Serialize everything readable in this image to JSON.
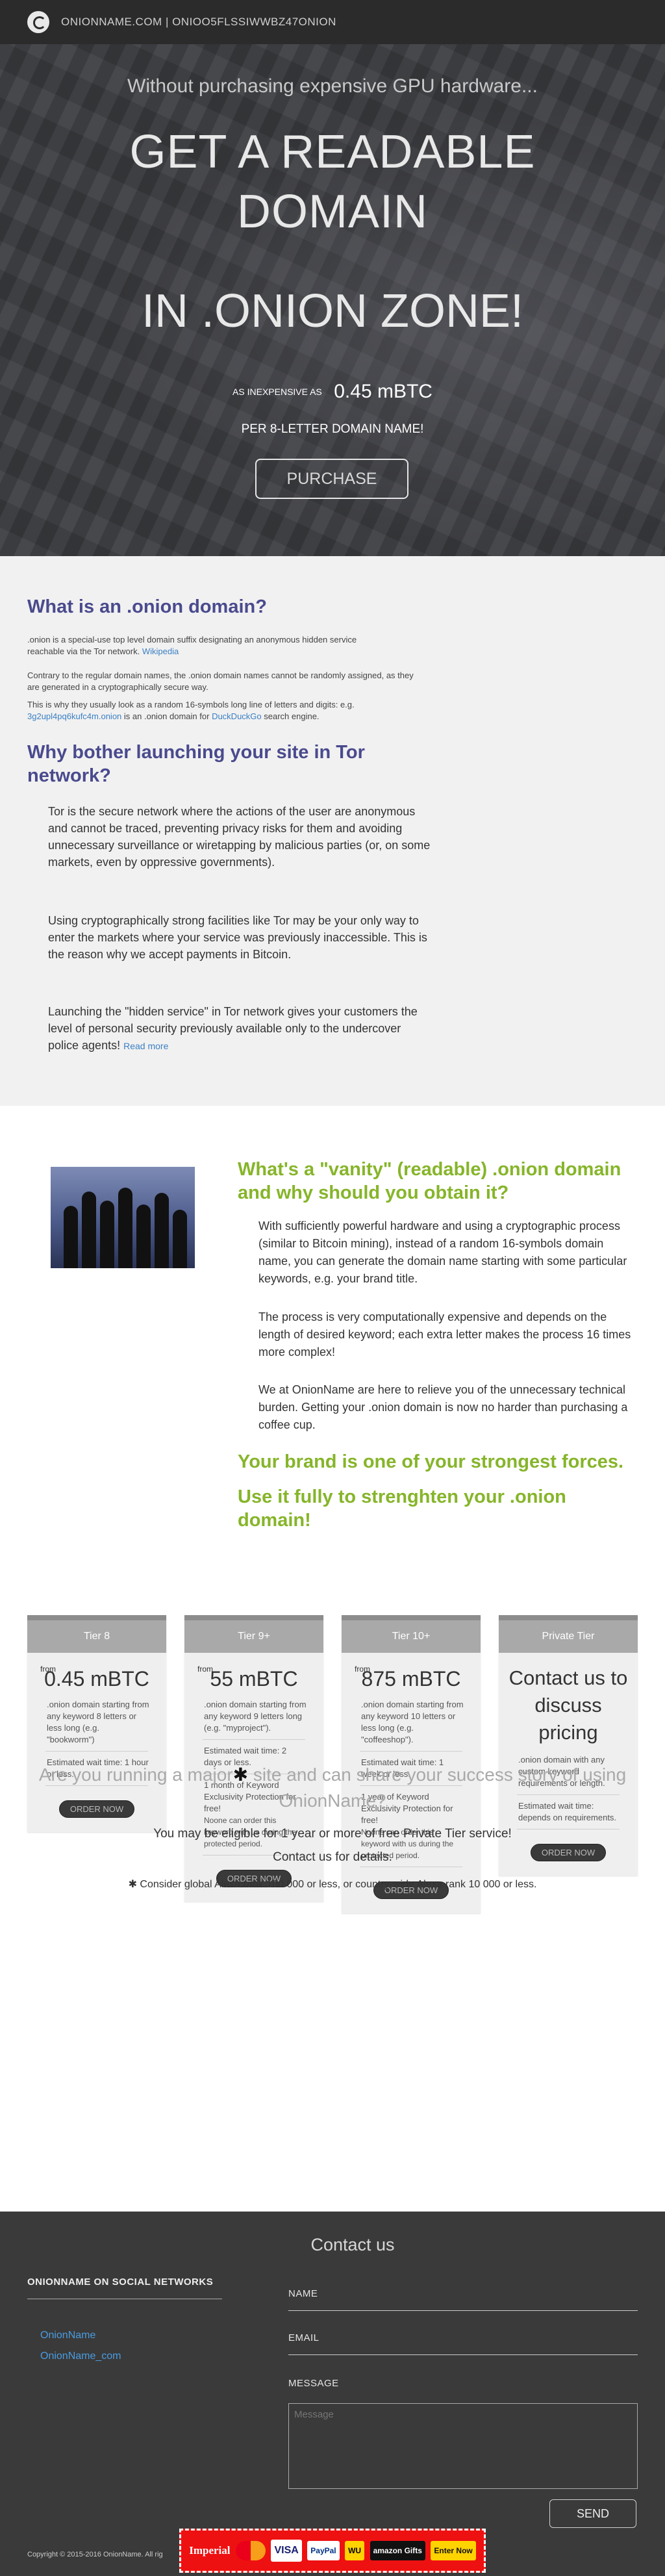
{
  "nav": {
    "brand": "ONIONNAME.COM  |  ONIOO5FLSSIWWBZ47ONION",
    "logo_icon": "onion-logo-icon"
  },
  "hero": {
    "subtitle": "Without purchasing expensive GPU hardware...",
    "headline_line1": "GET A READABLE",
    "headline_line2": "DOMAIN",
    "headline_line3": "IN .ONION ZONE!",
    "price_prefix": "AS INEXPENSIVE AS",
    "price": "0.45 mBTC",
    "per": "PER 8-LETTER DOMAIN NAME!",
    "purchase_label": "PURCHASE"
  },
  "what": {
    "title": "What is an .onion domain?",
    "p1_a": ".onion is a special-use top level domain suffix designating an anonymous hidden service",
    "p1_b": "reachable via the Tor network.",
    "p1_link": "Wikipedia",
    "p2": "Contrary to the regular domain names, the .onion domain names cannot be randomly assigned, as they are generated in a cryptographically secure way.",
    "p3_a": "This is why they usually look as a random 16-symbols long line of letters and digits: e.g.",
    "p3_link1": "3g2upl4pq6kufc4m.onion",
    "p3_b": "is an .onion domain for",
    "p3_link2": "DuckDuckGo",
    "p3_c": "search engine.",
    "title2": "Why bother launching your site in Tor network?",
    "b1": "Tor is the secure network where the actions of the user are anonymous and cannot be traced, preventing privacy risks for them and avoiding unnecessary surveillance or wiretapping by malicious parties (or, on some markets, even by oppressive governments).",
    "b2": "Using cryptographically strong facilities like Tor may be your only way to enter the markets where your service was previously inaccessible. This is the reason why we accept payments in Bitcoin.",
    "b3": "Launching the \"hidden service\" in Tor network gives your customers the level of personal security previously available only to the undercover police agents!",
    "read_more": "Read more"
  },
  "vanity": {
    "image_desc": "people-silhouettes-image",
    "title": "What's a \"vanity\" (readable) .onion domain and why should you obtain it?",
    "p1": "With sufficiently powerful hardware and using a cryptographic process (similar to Bitcoin mining), instead of a random 16-symbols domain name, you can generate the domain name starting with some particular keywords, e.g. your brand title.",
    "p2": "The process is very computationally expensive and depends on the length of desired keyword; each extra letter makes the process 16 times more complex!",
    "p3": "We at OnionName are here to relieve you of the unnecessary technical burden. Getting your .onion domain is now no harder than purchasing a coffee cup.",
    "slogan1": "Your brand is one of your strongest forces.",
    "slogan2": "Use it fully to strenghten your .onion domain!"
  },
  "pricing": {
    "tiers": [
      {
        "name": "Tier 8",
        "currency": "from",
        "price": "0.45 mBTC",
        "l1": ".onion domain starting from any keyword 8 letters or less long (e.g. \"bookworm\")",
        "wait": "Estimated wait time: 1 hour or less.",
        "order": "ORDER NOW"
      },
      {
        "name": "Tier 9+",
        "currency": "from",
        "price": "55 mBTC",
        "l1": ".onion domain starting from any keyword 9 letters long (e.g. \"myproject\").",
        "wait": "Estimated wait time: 2 days or less.",
        "excl": "1 month of Keyword Exclusivity Protection for free!",
        "excl_note": "Noone can order this keyword with us during the protected period.",
        "order": "ORDER NOW"
      },
      {
        "name": "Tier 10+",
        "currency": "from",
        "price": "875 mBTC",
        "l1": ".onion domain starting from any keyword 10 letters or less long (e.g. \"coffeeshop\").",
        "wait": "Estimated wait time: 1 week or less.",
        "excl": "1 year of Keyword Exclusivity Protection for free!",
        "excl_note": "Noone can order this keyword with us during the protected period.",
        "order": "ORDER NOW"
      },
      {
        "name": "Private Tier",
        "contact": "Contact us to discuss pricing",
        "l1": ".onion domain with any custom keyword requirements or length.",
        "wait": "Estimated wait time: depends on requirements.",
        "order": "ORDER NOW"
      }
    ],
    "major_q_a": "Are you running a major",
    "major_q_b": "site and can share your success story of using OnionName?",
    "major_t": "You may be eligible for 1 year or more of free Private Tier service!",
    "major_t2": "Contact us for details.",
    "major_f": "Consider global Alexa rank 100 000 or less, or country-wide Alexa rank 10 000 or less.",
    "asterisk_icon": "asterisk-icon"
  },
  "footer": {
    "contact_title": "Contact us",
    "social_title": "ONIONNAME ON SOCIAL NETWORKS",
    "social": [
      "OnionName",
      "OnionName_com"
    ],
    "name_label": "NAME",
    "email_label": "EMAIL",
    "message_label": "MESSAGE",
    "message_placeholder": "Message",
    "send_label": "SEND",
    "copyright": "Copyright © 2015-2016 OnionName. All rig",
    "badges": [
      "Imperial",
      "MasterCard",
      "VISA",
      "PayPal",
      "WU",
      "amazon Gifts",
      "Enter Now"
    ]
  }
}
